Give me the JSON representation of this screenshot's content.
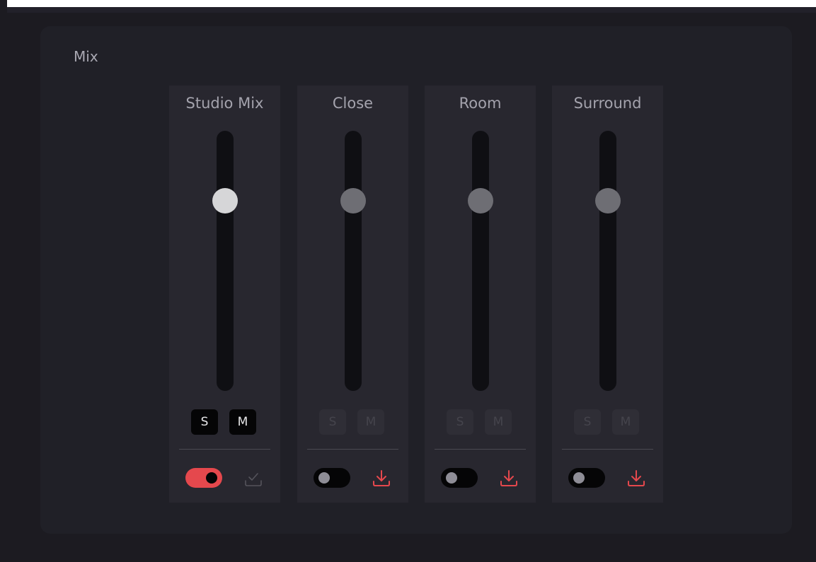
{
  "panel": {
    "title": "Mix"
  },
  "channels": [
    {
      "name": "Studio Mix",
      "solo_label": "S",
      "mute_label": "M",
      "fader_level": 0.73,
      "selected": true,
      "toggle_on": true,
      "action_icon": "check-icon"
    },
    {
      "name": "Close",
      "solo_label": "S",
      "mute_label": "M",
      "fader_level": 0.73,
      "selected": false,
      "toggle_on": false,
      "action_icon": "download-icon"
    },
    {
      "name": "Room",
      "solo_label": "S",
      "mute_label": "M",
      "fader_level": 0.73,
      "selected": false,
      "toggle_on": false,
      "action_icon": "download-icon"
    },
    {
      "name": "Surround",
      "solo_label": "S",
      "mute_label": "M",
      "fader_level": 0.73,
      "selected": false,
      "toggle_on": false,
      "action_icon": "download-icon"
    }
  ],
  "colors": {
    "accent": "#e5484d",
    "background": "#1c1b21",
    "panel": "#202027",
    "channel_strip": "#28272f"
  }
}
